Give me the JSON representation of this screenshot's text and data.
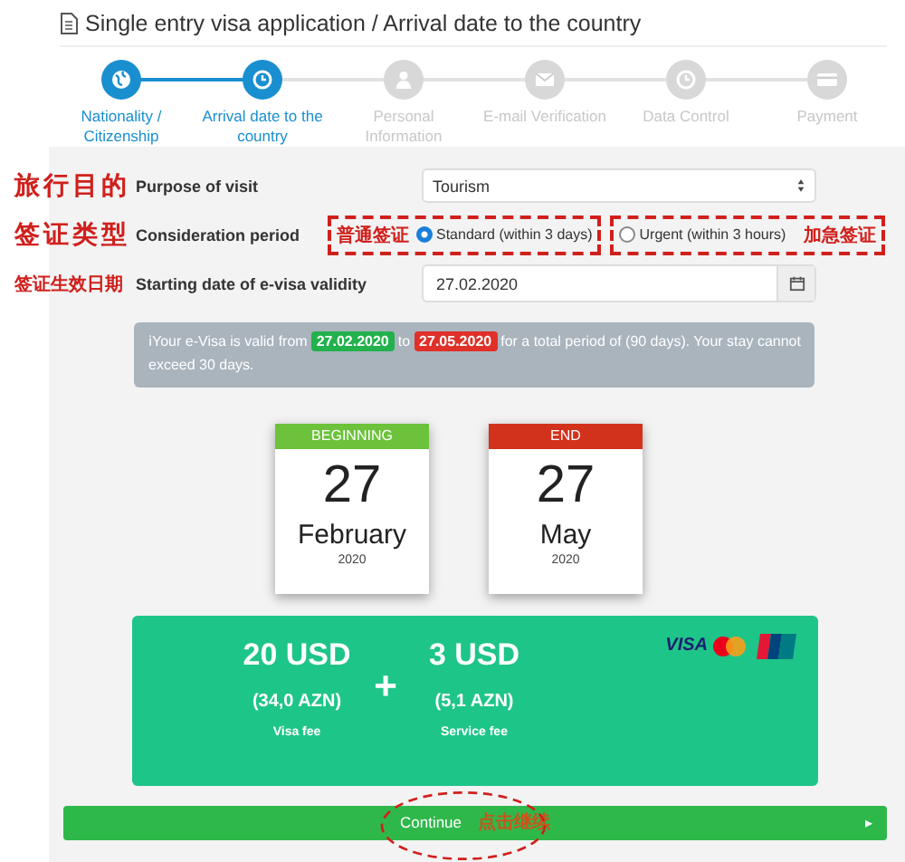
{
  "title": "Single entry visa application / Arrival date to the country",
  "steps": [
    {
      "label": "Nationality / Citizenship",
      "completed": true
    },
    {
      "label": "Arrival date to the country",
      "completed": true
    },
    {
      "label": "Personal Information",
      "completed": false
    },
    {
      "label": "E-mail Verification",
      "completed": false
    },
    {
      "label": "Data Control",
      "completed": false
    },
    {
      "label": "Payment",
      "completed": false
    }
  ],
  "form": {
    "purpose": {
      "note": "旅行目的",
      "label": "Purpose of visit",
      "value": "Tourism"
    },
    "period": {
      "note": "签证类型",
      "label": "Consideration period",
      "options": [
        {
          "note": "普通签证",
          "label": "Standard (within 3 days)",
          "selected": true
        },
        {
          "note": "加急签证",
          "label": "Urgent (within 3 hours)",
          "selected": false
        }
      ]
    },
    "start": {
      "note": "签证生效日期",
      "label": "Starting date of e-visa validity",
      "value": "27.02.2020"
    }
  },
  "info": {
    "icon": "ℹ",
    "prefix": "Your e-Visa is valid from",
    "from": "27.02.2020",
    "middle": "to",
    "to": "27.05.2020",
    "suffix": "for a total period of (90 days). Your stay cannot",
    "suffix_continued": "exceed 30 days."
  },
  "calendars": [
    {
      "header": "BEGINNING",
      "day": "27",
      "month": "February",
      "year": "2020",
      "color": "#6cc23a"
    },
    {
      "header": "END",
      "day": "27",
      "month": "May",
      "year": "2020",
      "color": "#d2321c"
    }
  ],
  "fees": [
    {
      "amount": "20 USD",
      "converted": "(34,0 AZN)",
      "label": "Visa fee"
    },
    {
      "amount": "3 USD",
      "converted": "(5,1 AZN)",
      "label": "Service fee"
    }
  ],
  "fee_operator": "+",
  "card_brand": "VISA",
  "continue": {
    "label": "Continue",
    "note": "点击继续",
    "arrow": "▸"
  }
}
